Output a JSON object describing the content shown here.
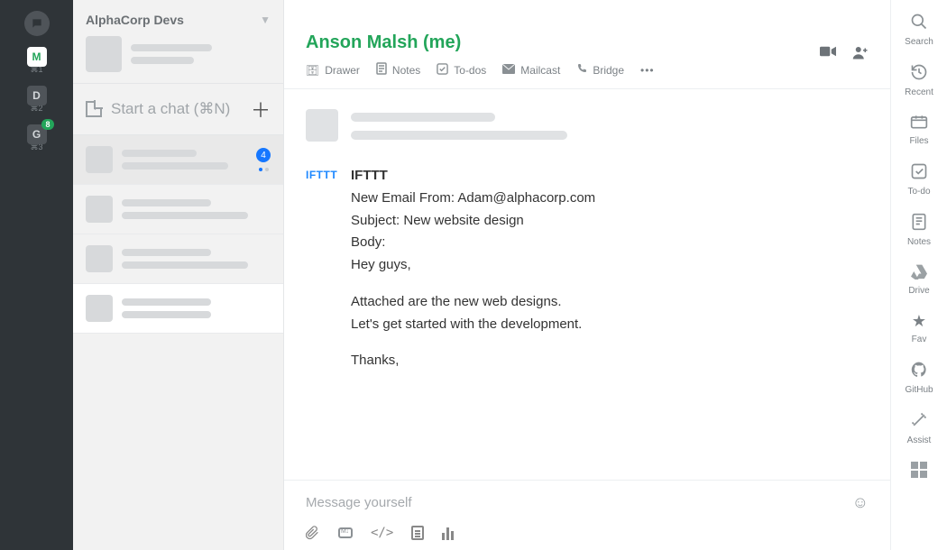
{
  "appbar": {
    "spaces": [
      {
        "letter": "M",
        "shortcut": "⌘1",
        "active": true
      },
      {
        "letter": "D",
        "shortcut": "⌘2",
        "active": false
      },
      {
        "letter": "G",
        "shortcut": "⌘3",
        "active": false,
        "badge": "8"
      }
    ]
  },
  "sidebar": {
    "workspace_name": "AlphaCorp Devs",
    "new_chat_label": "Start a chat (⌘N)",
    "items": [
      {
        "unread_badge": "4",
        "selected": true
      },
      {
        "selected": false
      },
      {
        "selected": false
      },
      {
        "selected": false
      }
    ]
  },
  "conversation": {
    "title": "Anson Malsh (me)",
    "tabs": {
      "drawer": "Drawer",
      "notes": "Notes",
      "todos": "To-dos",
      "mailcast": "Mailcast",
      "bridge": "Bridge"
    },
    "ifttt": {
      "sender": "IFTTT",
      "line1": "New Email From: Adam@alphacorp.com",
      "line2": "Subject: New website design",
      "line3": "Body:",
      "line4": "Hey guys,",
      "line5": "Attached are the new web designs.",
      "line6": "Let's get started with the development.",
      "line7": "Thanks,"
    },
    "composer_placeholder": "Message yourself"
  },
  "rail": {
    "search": "Search",
    "recent": "Recent",
    "files": "Files",
    "todo": "To-do",
    "notes": "Notes",
    "drive": "Drive",
    "fav": "Fav",
    "github": "GitHub",
    "assist": "Assist"
  }
}
